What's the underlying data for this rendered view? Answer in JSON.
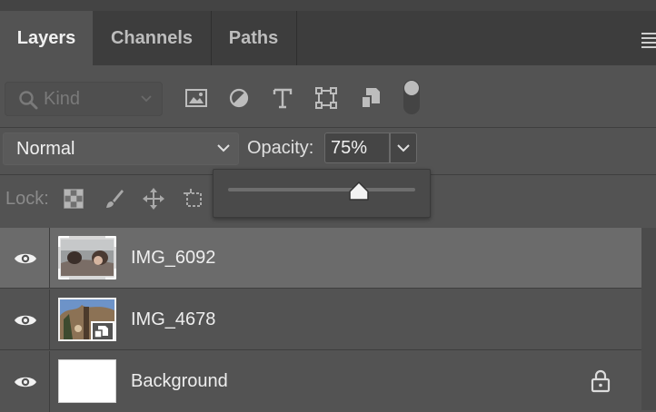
{
  "panel": {
    "tabs": [
      {
        "label": "Layers",
        "active": true
      },
      {
        "label": "Channels",
        "active": false
      },
      {
        "label": "Paths",
        "active": false
      }
    ]
  },
  "filter": {
    "kind_placeholder": "Kind",
    "icons": [
      "image-filter-icon",
      "adjustment-filter-icon",
      "type-filter-icon",
      "shape-filter-icon",
      "smart-object-filter-icon"
    ]
  },
  "blend": {
    "mode": "Normal",
    "opacity_label": "Opacity:",
    "opacity_value": "75%",
    "opacity_slider_fraction": 0.7
  },
  "lock": {
    "label": "Lock:",
    "icons": [
      "lock-transparent-pixels-icon",
      "lock-image-pixels-icon",
      "lock-position-icon",
      "lock-artboard-icon"
    ]
  },
  "layers": [
    {
      "name": "IMG_6092",
      "selected": true,
      "visible": true
    },
    {
      "name": "IMG_4678",
      "selected": false,
      "visible": true,
      "smart_object": true
    },
    {
      "name": "Background",
      "selected": false,
      "visible": true,
      "locked": true
    }
  ],
  "colors": {
    "panel_bg": "#535353",
    "tab_bar_bg": "#3d3d3d",
    "selected_row": "#6b6b6b"
  }
}
